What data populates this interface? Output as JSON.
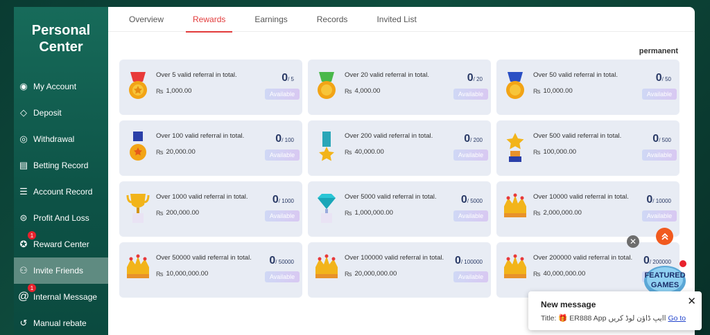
{
  "sidebar": {
    "title_line1": "Personal",
    "title_line2": "Center",
    "items": [
      {
        "label": "My Account",
        "icon": "user-circle-icon"
      },
      {
        "label": "Deposit",
        "icon": "ticket-icon"
      },
      {
        "label": "Withdrawal",
        "icon": "chart-icon"
      },
      {
        "label": "Betting Record",
        "icon": "document-icon"
      },
      {
        "label": "Account Record",
        "icon": "list-icon"
      },
      {
        "label": "Profit And Loss",
        "icon": "list-alt-icon"
      },
      {
        "label": "Reward Center",
        "icon": "gift-icon",
        "badge": "1"
      },
      {
        "label": "Invite Friends",
        "icon": "add-user-icon",
        "active": true
      },
      {
        "label": "Internal Message",
        "icon": "at-icon",
        "badge": "1"
      },
      {
        "label": "Manual rebate",
        "icon": "rebate-icon"
      }
    ]
  },
  "tabs": [
    "Overview",
    "Rewards",
    "Earnings",
    "Records",
    "Invited List"
  ],
  "active_tab": "Rewards",
  "permanent_label": "permanent",
  "currency_icon": "₨",
  "cards": [
    {
      "desc": "Over 5 valid referral in total.",
      "amount": "1,000.00",
      "progress": "0",
      "total": "/ 5",
      "status": "Available",
      "medal": "red-medal"
    },
    {
      "desc": "Over 20 valid referral in total.",
      "amount": "4,000.00",
      "progress": "0",
      "total": "/ 20",
      "status": "Available",
      "medal": "green-medal"
    },
    {
      "desc": "Over 50 valid referral in total.",
      "amount": "10,000.00",
      "progress": "0",
      "total": "/ 50",
      "status": "Available",
      "medal": "blue-medal"
    },
    {
      "desc": "Over 100 valid referral in total.",
      "amount": "20,000.00",
      "progress": "0",
      "total": "/ 100",
      "status": "Available",
      "medal": "star-medal"
    },
    {
      "desc": "Over 200 valid referral in total.",
      "amount": "40,000.00",
      "progress": "0",
      "total": "/ 200",
      "status": "Available",
      "medal": "star-ribbon"
    },
    {
      "desc": "Over 500 valid referral in total.",
      "amount": "100,000.00",
      "progress": "0",
      "total": "/ 500",
      "status": "Available",
      "medal": "star-trophy"
    },
    {
      "desc": "Over 1000 valid referral in total.",
      "amount": "200,000.00",
      "progress": "0",
      "total": "/ 1000",
      "status": "Available",
      "medal": "cup-trophy"
    },
    {
      "desc": "Over 5000 valid referral in total.",
      "amount": "1,000,000.00",
      "progress": "0",
      "total": "/ 5000",
      "status": "Available",
      "medal": "diamond-trophy"
    },
    {
      "desc": "Over 10000 valid referral in total.",
      "amount": "2,000,000.00",
      "progress": "0",
      "total": "/ 10000",
      "status": "Available",
      "medal": "crown"
    },
    {
      "desc": "Over 50000 valid referral in total.",
      "amount": "10,000,000.00",
      "progress": "0",
      "total": "/ 50000",
      "status": "Available",
      "medal": "crown"
    },
    {
      "desc": "Over 100000 valid referral in total.",
      "amount": "20,000,000.00",
      "progress": "0",
      "total": "/ 100000",
      "status": "Available",
      "medal": "crown"
    },
    {
      "desc": "Over 200000 valid referral in total.",
      "amount": "40,000,000.00",
      "progress": "0",
      "total": "/ 200000",
      "status": "Available",
      "medal": "crown"
    }
  ],
  "featured": {
    "label_line1": "FEATURED",
    "label_line2": "GAMES"
  },
  "notification": {
    "title": "New message",
    "prefix": "Title:",
    "message": "ER888 App اایپ ڈاؤن لوڈ کریں",
    "link": "Go to"
  },
  "colors": {
    "accent": "#e23b3b",
    "sidebar": "#0d5246",
    "card_bg": "#e8ecf4",
    "badge": "#e8222d"
  }
}
